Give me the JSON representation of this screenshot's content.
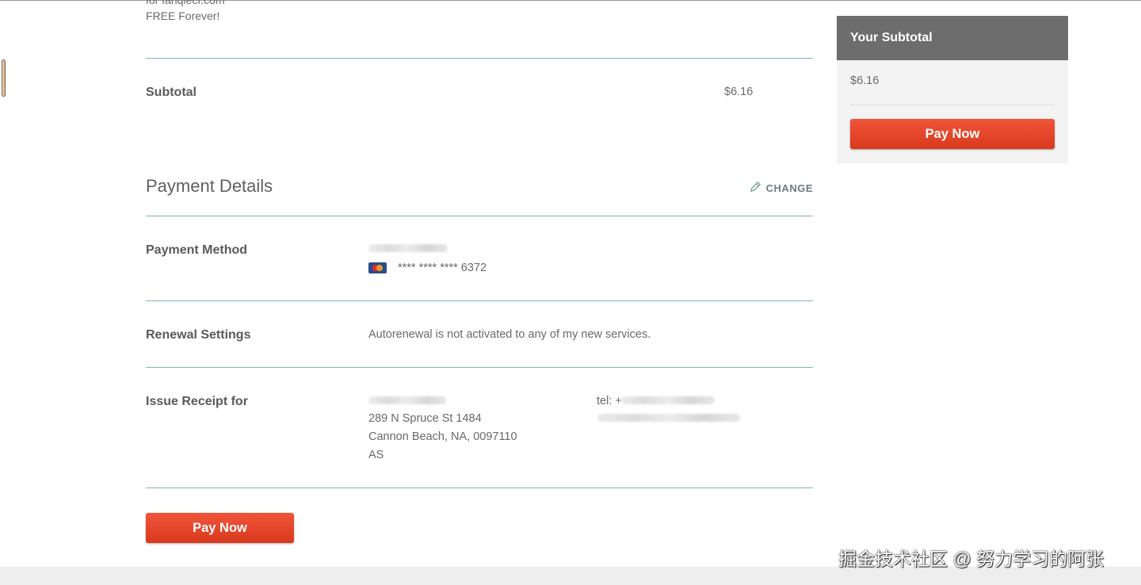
{
  "order": {
    "line_cut_top": "for fanqiecf.com",
    "line_free": "FREE Forever!",
    "subtotal_label": "Subtotal",
    "subtotal_value": "$6.16"
  },
  "payment_details": {
    "title": "Payment Details",
    "change_label": "CHANGE",
    "method_label": "Payment Method",
    "card_number": "**** **** **** 6372",
    "renewal_label": "Renewal Settings",
    "renewal_text": "Autorenewal is not activated to any of my new services.",
    "receipt_label": "Issue Receipt for",
    "address_line1": "289 N Spruce St 1484",
    "address_line2": "Cannon Beach, NA,  0097110",
    "address_line3": "AS",
    "tel_prefix": "tel: +"
  },
  "buttons": {
    "pay_now": "Pay Now"
  },
  "sidebar": {
    "title": "Your Subtotal",
    "amount": "$6.16",
    "pay_now": "Pay Now"
  },
  "watermark": "掘金技术社区 @ 努力学习的阿张",
  "icons": {
    "change": "pencil-icon",
    "card": "mastercard-icon"
  },
  "colors": {
    "accent": "#e64527",
    "divider": "#7fb6b6",
    "sidebar_header": "#6d6d6d"
  }
}
